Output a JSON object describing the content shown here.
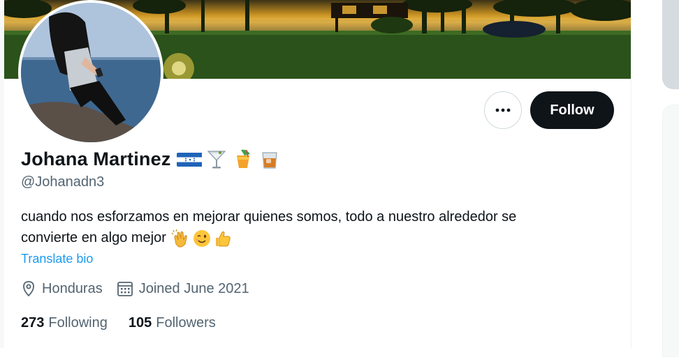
{
  "profile": {
    "display_name": "Johana Martinez",
    "name_emojis": [
      "honduras-flag-icon",
      "cocktail-glass-icon",
      "tropical-drink-icon",
      "tumbler-glass-icon"
    ],
    "handle": "@Johanadn3",
    "bio_line1": "cuando nos esforzamos en mejorar quienes somos, todo a nuestro alrededor se",
    "bio_line2": "convierte en algo mejor",
    "bio_emojis": [
      "clapping-hands-icon",
      "winking-face-icon",
      "thumbs-up-icon"
    ],
    "translate_label": "Translate bio",
    "location": "Honduras",
    "joined": "Joined June 2021",
    "following_count": "273",
    "following_label": "Following",
    "followers_count": "105",
    "followers_label": "Followers"
  },
  "actions": {
    "more_icon": "more-horizontal-icon",
    "follow_label": "Follow"
  },
  "colors": {
    "text_primary": "#0f1419",
    "text_secondary": "#536471",
    "link": "#1d9bf0",
    "follow_button_bg": "#0f1419"
  }
}
